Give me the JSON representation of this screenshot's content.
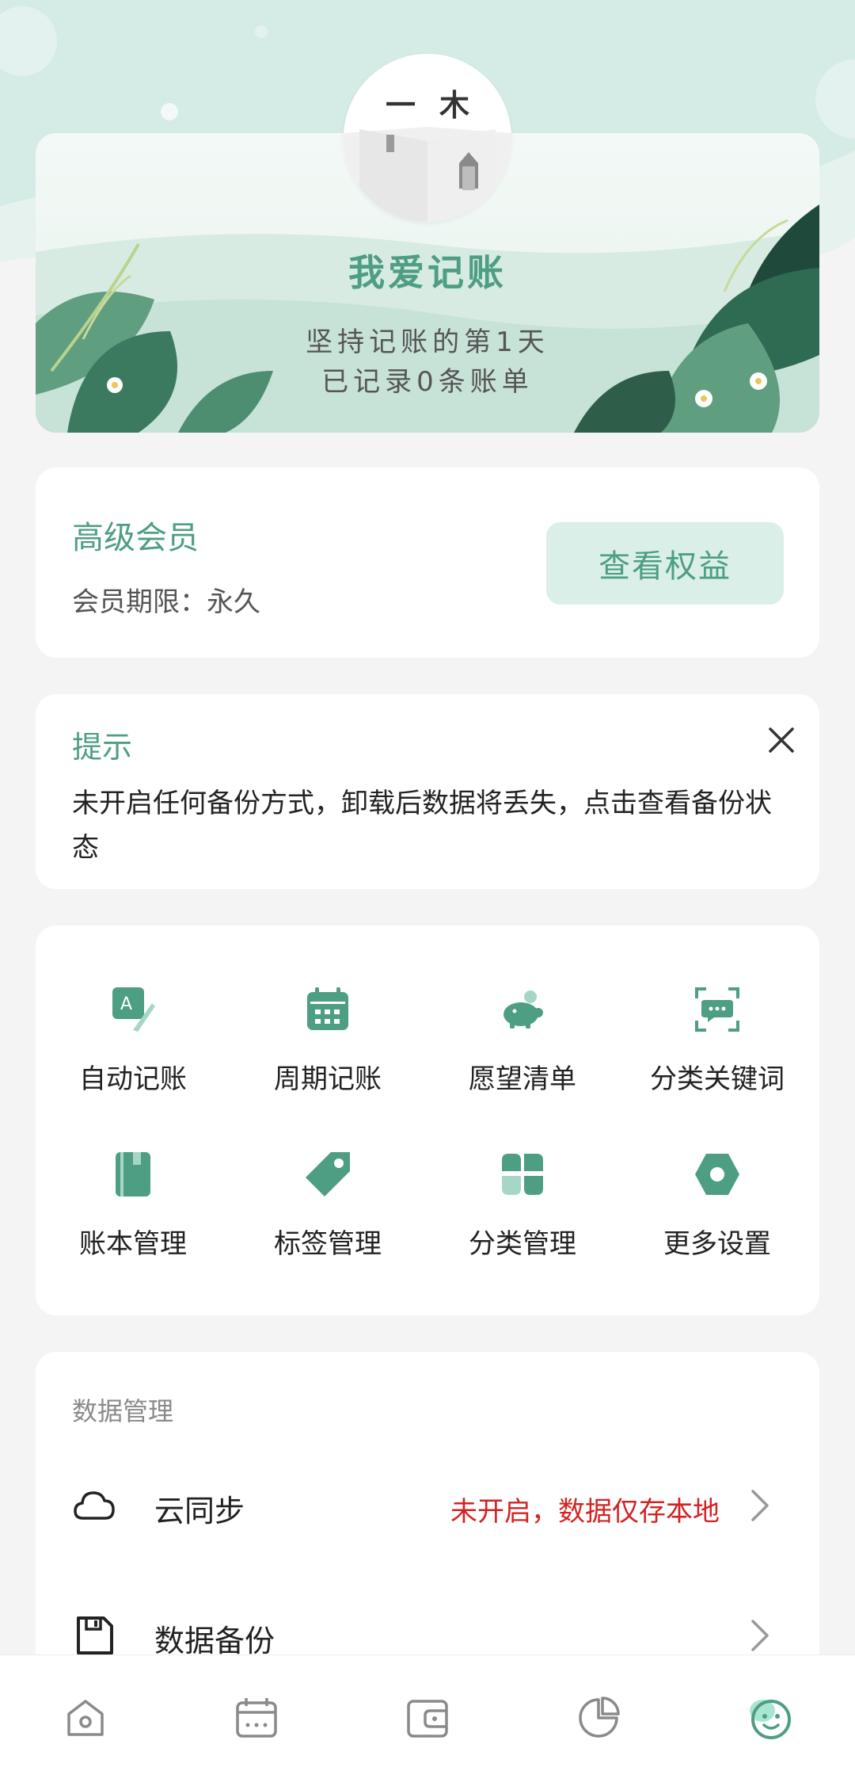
{
  "profile": {
    "avatar_text": "一木",
    "name": "我爱记账",
    "days_text": "坚持记账的第1天",
    "records_text": "已记录0条账单"
  },
  "member": {
    "title": "高级会员",
    "period": "会员期限：永久",
    "benefits_button": "查看权益"
  },
  "tip": {
    "title": "提示",
    "text": "未开启任何备份方式，卸载后数据将丢失，点击查看备份状态"
  },
  "features": [
    {
      "label": "自动记账",
      "icon": "auto-record-icon"
    },
    {
      "label": "周期记账",
      "icon": "calendar-icon"
    },
    {
      "label": "愿望清单",
      "icon": "piggy-bank-icon"
    },
    {
      "label": "分类关键词",
      "icon": "scan-chat-icon"
    },
    {
      "label": "账本管理",
      "icon": "ledger-book-icon"
    },
    {
      "label": "标签管理",
      "icon": "tag-icon"
    },
    {
      "label": "分类管理",
      "icon": "category-grid-icon"
    },
    {
      "label": "更多设置",
      "icon": "settings-hexagon-icon"
    }
  ],
  "data_management": {
    "title": "数据管理",
    "rows": [
      {
        "label": "云同步",
        "status": "未开启，数据仅存本地",
        "icon": "cloud-icon"
      },
      {
        "label": "数据备份",
        "status": "",
        "icon": "save-icon"
      }
    ]
  },
  "bottom_nav": [
    {
      "name": "home",
      "icon": "home-icon"
    },
    {
      "name": "calendar",
      "icon": "calendar-icon"
    },
    {
      "name": "wallet",
      "icon": "wallet-icon"
    },
    {
      "name": "stats",
      "icon": "pie-chart-icon"
    },
    {
      "name": "profile",
      "icon": "smile-face-icon",
      "active": true
    }
  ],
  "colors": {
    "accent": "#4e9e83",
    "accent_light": "#d9efe8",
    "warning": "#d32222",
    "background": "#f4f4f4",
    "card": "#ffffff",
    "nav_inactive": "#8a8a8a"
  }
}
